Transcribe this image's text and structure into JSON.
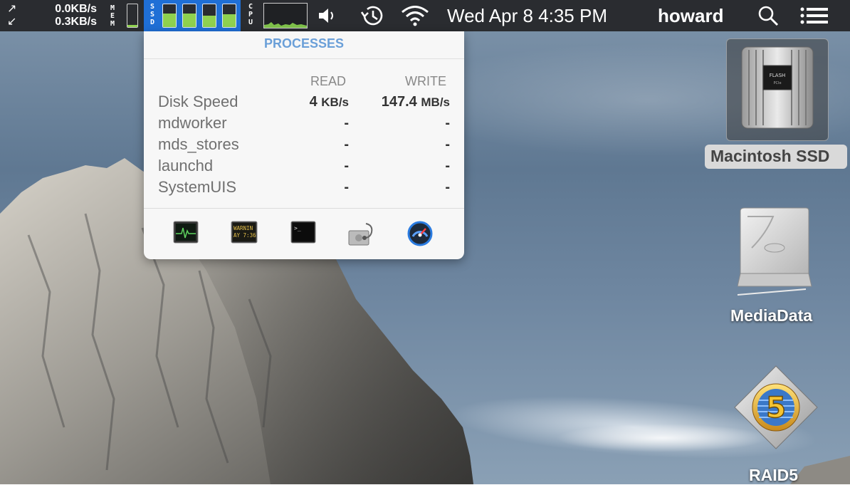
{
  "menubar": {
    "net": {
      "down_icon": "arrow-up-right-icon",
      "up_icon": "arrow-down-left-icon",
      "rate_top": "0.0KB/s",
      "rate_bottom": "0.3KB/s"
    },
    "mem": {
      "label": "MEM",
      "fill": 0.1
    },
    "ssd": {
      "label": "SSD",
      "fills": [
        0.6,
        0.6,
        0.5,
        0.55
      ]
    },
    "cpu": {
      "label": "CPU"
    },
    "volume_icon": "speaker-icon",
    "timemachine_icon": "time-machine-icon",
    "wifi_icon": "wifi-icon",
    "clock": "Wed Apr 8  4:35 PM",
    "user": "howard",
    "search_icon": "search-icon",
    "list_icon": "list-icon"
  },
  "popover": {
    "title": "PROCESSES",
    "columns": {
      "read": "READ",
      "write": "WRITE"
    },
    "rows": [
      {
        "name": "Disk Speed",
        "read_value": "4",
        "read_unit": "KB/s",
        "write_value": "147.4",
        "write_unit": "MB/s"
      },
      {
        "name": "mdworker",
        "read": "-",
        "write": "-"
      },
      {
        "name": "mds_stores",
        "read": "-",
        "write": "-"
      },
      {
        "name": "launchd",
        "read": "-",
        "write": "-"
      },
      {
        "name": "SystemUIS",
        "read": "-",
        "write": "-"
      }
    ],
    "tools": [
      {
        "icon": "activity-monitor-icon"
      },
      {
        "icon": "console-icon",
        "text1": "WARNIN",
        "text2": "AY 7:36"
      },
      {
        "icon": "terminal-icon",
        "text": ">_"
      },
      {
        "icon": "disk-utility-icon"
      },
      {
        "icon": "istat-icon"
      }
    ]
  },
  "desktop": {
    "icons": [
      {
        "label": "Macintosh SSD",
        "chip_text": "FLASH",
        "chip_sub": "PCIe"
      },
      {
        "label": "MediaData"
      },
      {
        "label": "RAID5",
        "badge": "5"
      }
    ]
  },
  "colors": {
    "menubar": "#2a2c30",
    "ssd_highlight": "#1f6fd6",
    "meter_green": "#8fd14f",
    "popover_title": "#6a9fd8"
  }
}
